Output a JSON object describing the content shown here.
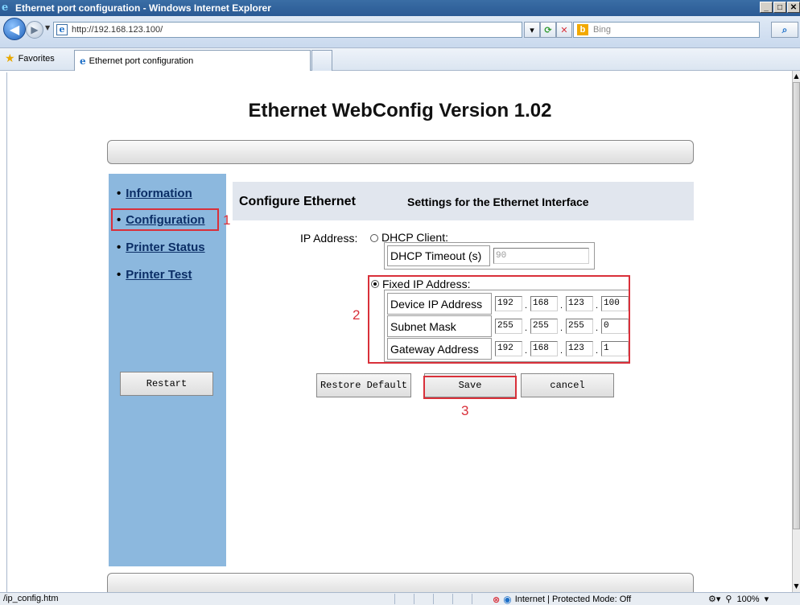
{
  "browser": {
    "window_title": "Ethernet port configuration - Windows Internet Explorer",
    "url": "http://192.168.123.100/",
    "search_placeholder": "Bing",
    "favorites_label": "Favorites",
    "tab_title": "Ethernet port configuration",
    "status_url": "/ip_config.htm",
    "status_zone": "Internet | Protected Mode: Off",
    "zoom": "100%"
  },
  "page": {
    "title": "Ethernet WebConfig Version 1.02"
  },
  "sidebar": {
    "items": [
      {
        "label": "Information"
      },
      {
        "label": "Configuration"
      },
      {
        "label": "Printer Status"
      },
      {
        "label": "Printer Test"
      }
    ],
    "restart_label": "Restart"
  },
  "config": {
    "title": "Configure Ethernet",
    "subtitle": "Settings for the Ethernet Interface",
    "ip_address_label": "IP Address:",
    "dhcp_option_label": "DHCP Client:",
    "dhcp_timeout_label": "DHCP Timeout (s)",
    "dhcp_timeout_value": "90",
    "fixed_option_label": "Fixed IP Address:",
    "selected_mode": "fixed",
    "rows": [
      {
        "label": "Device IP Address",
        "octets": [
          "192",
          "168",
          "123",
          "100"
        ]
      },
      {
        "label": "Subnet Mask",
        "octets": [
          "255",
          "255",
          "255",
          "0"
        ]
      },
      {
        "label": "Gateway Address",
        "octets": [
          "192",
          "168",
          "123",
          "1"
        ]
      }
    ],
    "buttons": {
      "restore_default": "Restore Default",
      "save": "Save",
      "cancel": "cancel"
    }
  },
  "annotations": {
    "one": "1",
    "two": "2",
    "three": "3",
    "color": "#d9303a"
  },
  "colors": {
    "sidebar_bg": "#8cb8de",
    "header_bg": "#e1e6ee",
    "link": "#0b2e66"
  }
}
